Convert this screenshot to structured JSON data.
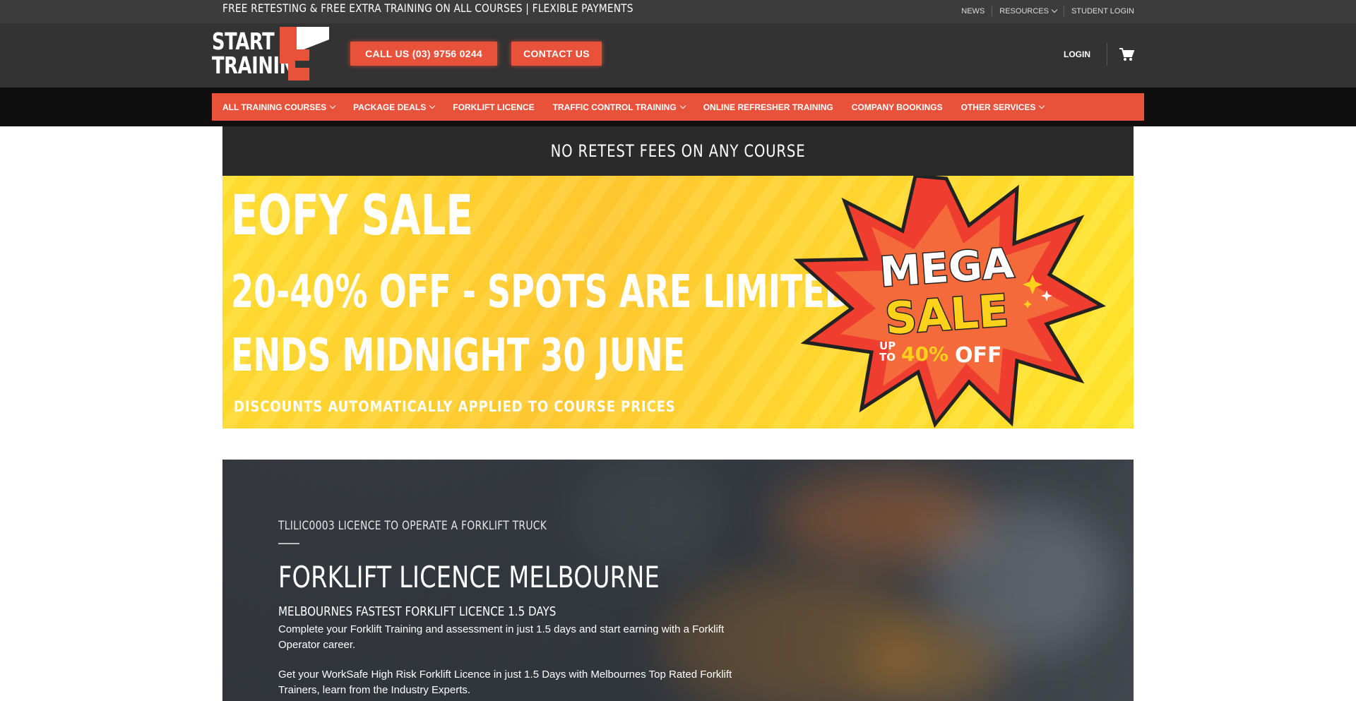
{
  "topbar": {
    "promo": "FREE RETESTING & FREE EXTRA TRAINING ON ALL COURSES | FLEXIBLE PAYMENTS",
    "links": [
      "NEWS",
      "RESOURCES",
      "STUDENT LOGIN"
    ]
  },
  "header": {
    "logo_line1": "START",
    "logo_line2": "TRAINING",
    "call_button": "CALL US (03) 9756 0244",
    "contact_button": "CONTACT US",
    "login": "LOGIN",
    "cart_icon": "cart-icon"
  },
  "nav": {
    "items": [
      {
        "label": "ALL TRAINING COURSES",
        "dropdown": true
      },
      {
        "label": "PACKAGE DEALS",
        "dropdown": true
      },
      {
        "label": "FORKLIFT LICENCE",
        "dropdown": false
      },
      {
        "label": "TRAFFIC CONTROL TRAINING",
        "dropdown": true
      },
      {
        "label": "ONLINE REFRESHER TRAINING",
        "dropdown": false
      },
      {
        "label": "COMPANY BOOKINGS",
        "dropdown": false
      },
      {
        "label": "OTHER SERVICES",
        "dropdown": true
      }
    ]
  },
  "notice": "NO RETEST FEES ON ANY COURSE",
  "banner": {
    "line1": "EOFY SALE",
    "line2": "20-40% OFF - SPOTS ARE LIMITED",
    "line3": "ENDS MIDNIGHT 30 JUNE",
    "line4": "DISCOUNTS AUTOMATICALLY APPLIED TO COURSE PRICES",
    "badge_mega": "MEGA",
    "badge_sale": "SALE",
    "badge_up": "UP",
    "badge_to": "TO",
    "badge_percent": "40%",
    "badge_off": "OFF"
  },
  "hero": {
    "kicker": "TLILIC0003 LICENCE TO OPERATE A FORKLIFT TRUCK",
    "title": "FORKLIFT LICENCE MELBOURNE",
    "subtitle": "MELBOURNES FASTEST FORKLIFT LICENCE 1.5 DAYS",
    "para1": "Complete your Forklift Training and assessment in just 1.5 days and start earning with a Forklift Operator career.",
    "para2": "Get your WorkSafe High Risk Forklift Licence in just 1.5 Days with Melbournes Top Rated Forklift Trainers, learn from the Industry Experts."
  },
  "colors": {
    "accent": "#e8523b",
    "topbar": "#3c3c3c",
    "header": "#333333",
    "navbar_bg": "#0f0f0f",
    "banner_yellow": "#ffd633"
  }
}
